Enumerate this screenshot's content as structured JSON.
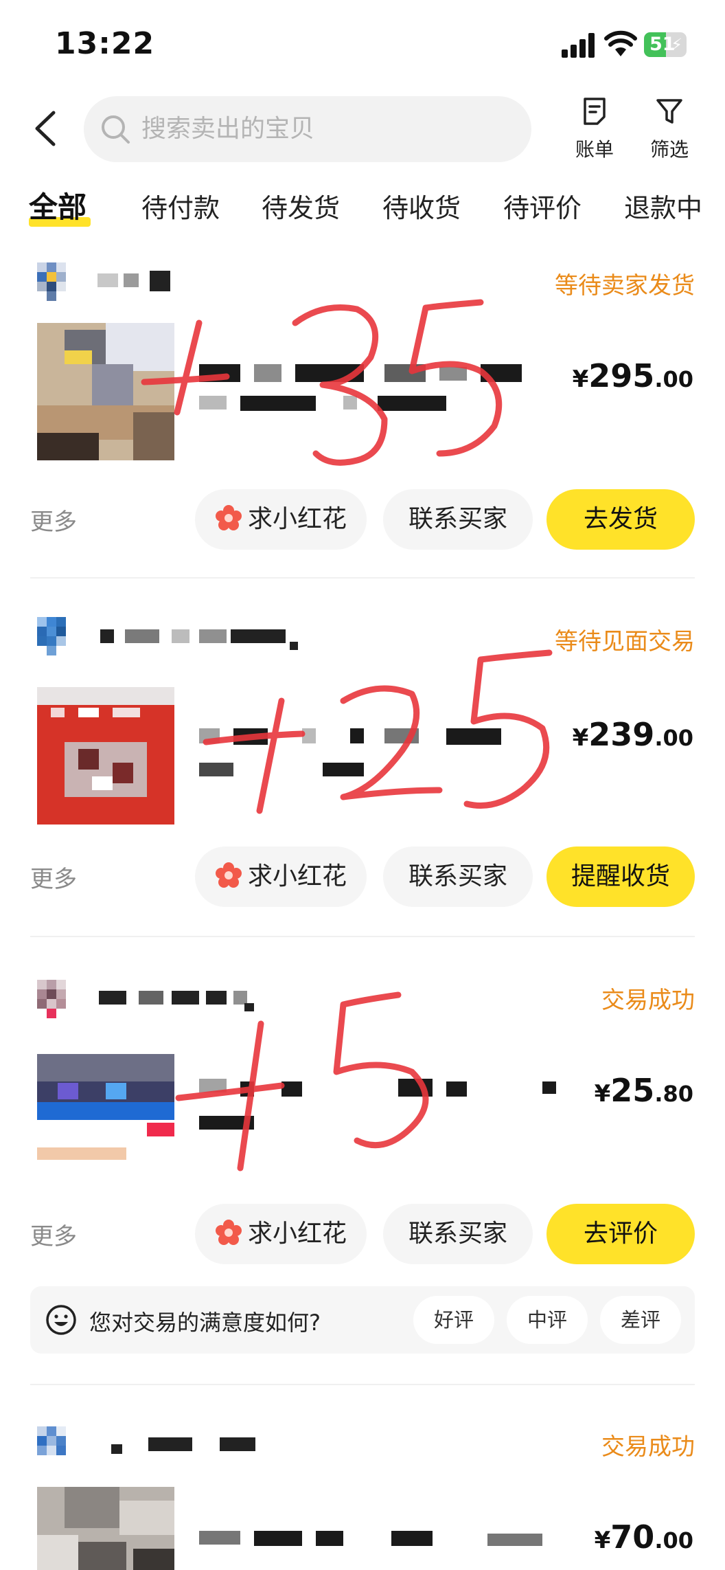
{
  "status_bar": {
    "time": "13:22",
    "battery": "51",
    "battery_level": 0.51
  },
  "header": {
    "search_placeholder": "搜索卖出的宝贝",
    "bill_label": "账单",
    "filter_label": "筛选"
  },
  "tabs": [
    {
      "label": "全部",
      "active": true
    },
    {
      "label": "待付款"
    },
    {
      "label": "待发货"
    },
    {
      "label": "待收货"
    },
    {
      "label": "待评价"
    },
    {
      "label": "退款中"
    }
  ],
  "orders": [
    {
      "status": "等待卖家发货",
      "price_currency": "¥",
      "price_int": "295",
      "price_dec": ".00",
      "more_label": "更多",
      "flower_label": "求小红花",
      "contact_label": "联系买家",
      "action_label": "去发货"
    },
    {
      "status": "等待见面交易",
      "price_currency": "¥",
      "price_int": "239",
      "price_dec": ".00",
      "more_label": "更多",
      "flower_label": "求小红花",
      "contact_label": "联系买家",
      "action_label": "提醒收货"
    },
    {
      "status": "交易成功",
      "price_currency": "¥",
      "price_int": "25",
      "price_dec": ".80",
      "more_label": "更多",
      "flower_label": "求小红花",
      "contact_label": "联系买家",
      "action_label": "去评价"
    },
    {
      "status": "交易成功",
      "price_currency": "¥",
      "price_int": "70",
      "price_dec": ".00"
    }
  ],
  "feedback": {
    "question": "您对交易的满意度如何?",
    "good": "好评",
    "neutral": "中评",
    "bad": "差评"
  },
  "annotations": [
    "+35",
    "+25",
    "+5"
  ],
  "colors": {
    "accent_yellow": "#ffe229",
    "status_orange": "#ea8b1a",
    "annotation_red": "#e8363c"
  }
}
